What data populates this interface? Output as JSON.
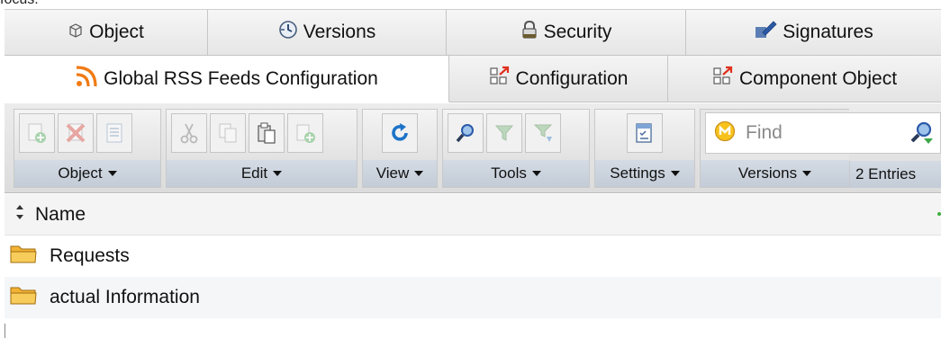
{
  "top_partial": {
    "text": "focus."
  },
  "tabs_row1": [
    {
      "label": "Object",
      "icon": "object-icon"
    },
    {
      "label": "Versions",
      "icon": "versions-icon"
    },
    {
      "label": "Security",
      "icon": "lock-icon"
    },
    {
      "label": "Signatures",
      "icon": "signature-icon"
    }
  ],
  "tabs_row2": [
    {
      "label": "Global RSS Feeds Configuration",
      "icon": "rss-icon",
      "active": true
    },
    {
      "label": "Configuration",
      "icon": "component-icon"
    },
    {
      "label": "Component Object",
      "icon": "component-icon"
    }
  ],
  "toolbar": {
    "groups": [
      {
        "label": "Object",
        "buttons": [
          "add-icon",
          "delete-icon",
          "properties-icon"
        ]
      },
      {
        "label": "Edit",
        "buttons": [
          "cut-icon",
          "copy-icon",
          "paste-icon",
          "paste-special-icon"
        ]
      },
      {
        "label": "View",
        "buttons": [
          "refresh-icon"
        ]
      },
      {
        "label": "Tools",
        "buttons": [
          "search-icon",
          "filter-icon",
          "filter-down-icon"
        ]
      },
      {
        "label": "Settings",
        "buttons": [
          "settings-icon"
        ]
      },
      {
        "label": "Versions",
        "buttons": []
      }
    ],
    "find_placeholder": "Find",
    "entries_text": "2 Entries"
  },
  "list": {
    "header": "Name",
    "rows": [
      {
        "name": "Requests",
        "icon": "folder-icon"
      },
      {
        "name": "actual Information",
        "icon": "folder-icon"
      }
    ]
  },
  "colors": {
    "rss": "#f07a13",
    "folder": "#f2b233",
    "refresh": "#1e73c8",
    "delete": "#d93a2f",
    "add": "#3ea84a",
    "caret": "#111111"
  }
}
